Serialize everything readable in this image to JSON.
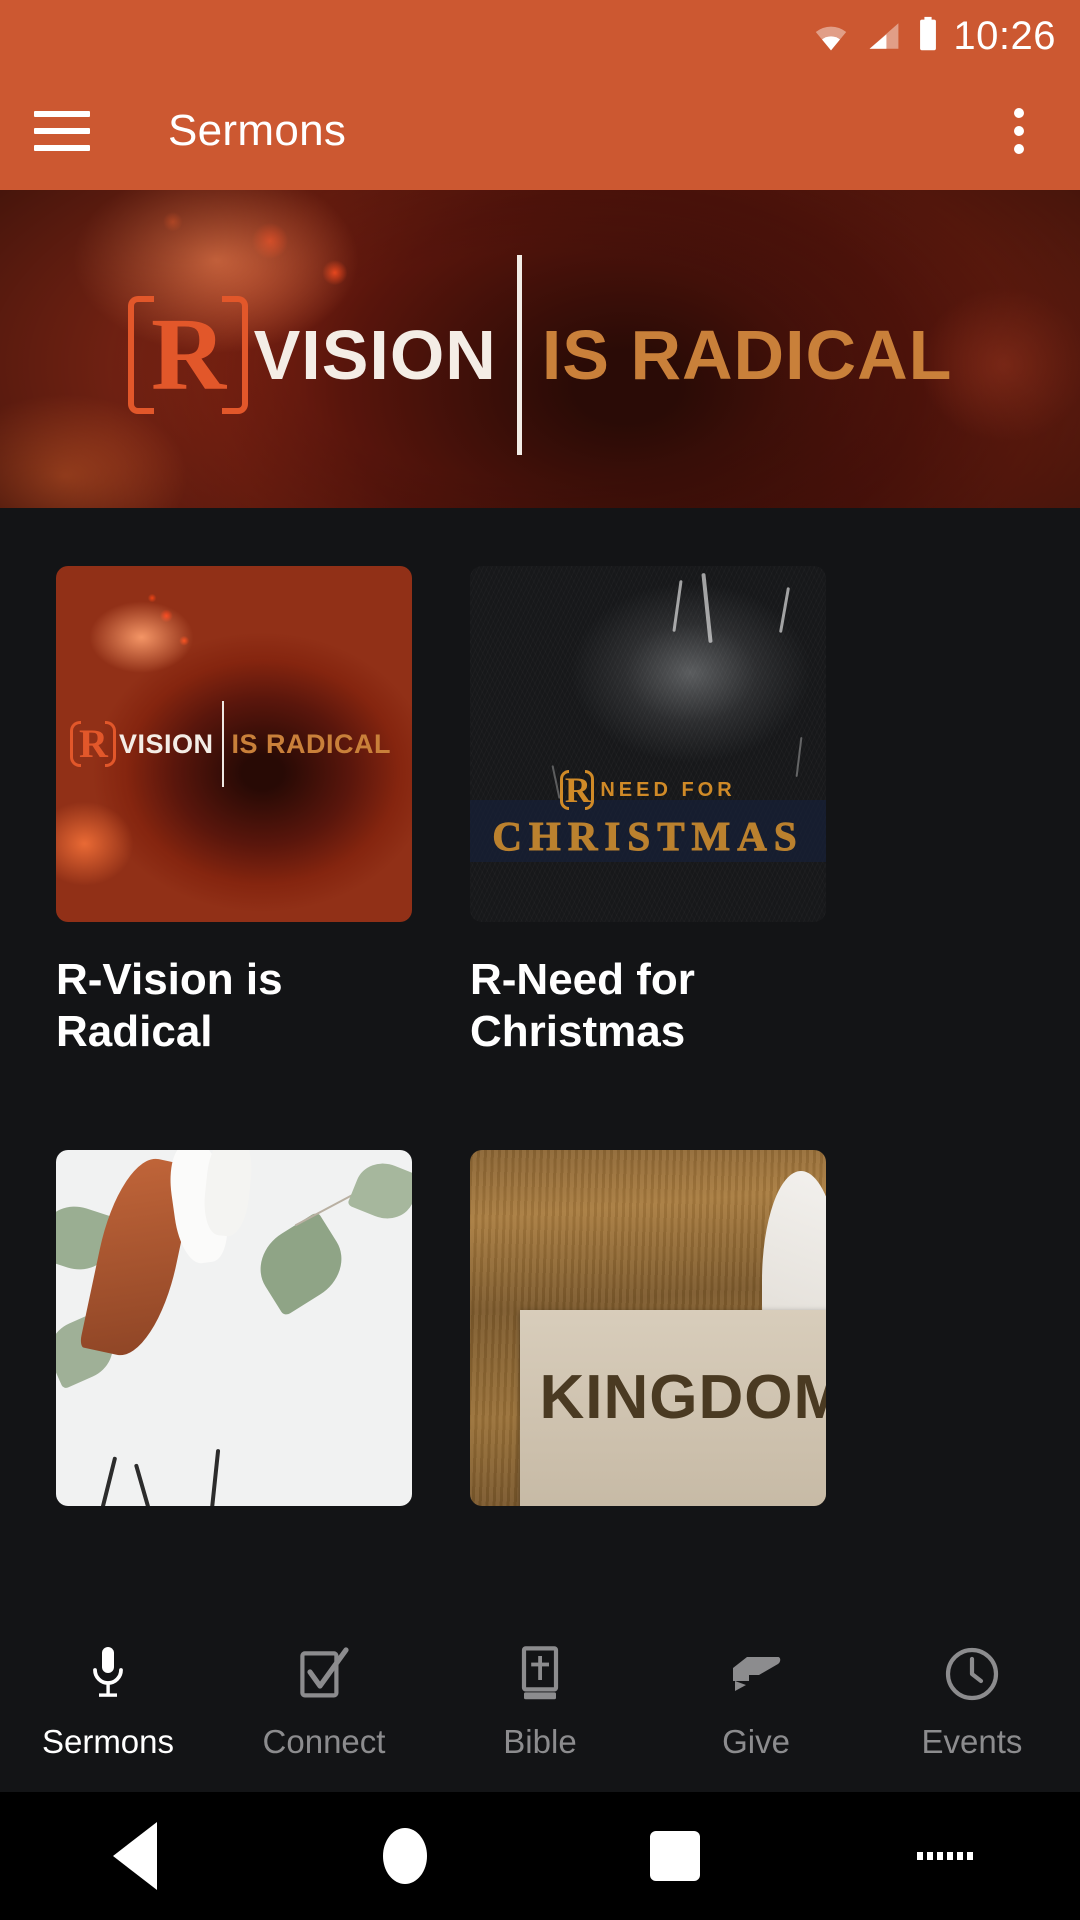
{
  "status_bar": {
    "time": "10:26",
    "icons": [
      "wifi-icon",
      "cellular-signal-icon",
      "battery-icon"
    ]
  },
  "app_bar": {
    "menu_icon": "hamburger-menu-icon",
    "title": "Sermons",
    "overflow_icon": "overflow-menu-icon",
    "background_color": "#CC5831"
  },
  "hero": {
    "logo_letter": "R",
    "word_primary": "VISION",
    "word_secondary": "IS RADICAL",
    "primary_color": "#F4EDE6",
    "secondary_color": "#C9803A",
    "logo_color": "#E2572A"
  },
  "sermon_series": [
    {
      "title": "R-Vision is Radical",
      "thumb_logo_letter": "R",
      "thumb_word_primary": "VISION",
      "thumb_word_secondary": "IS RADICAL"
    },
    {
      "title": "R-Need for Christmas",
      "thumb_logo_letter": "R",
      "thumb_word_primary": "NEED FOR",
      "thumb_word_secondary": "CHRISTMAS"
    },
    {
      "title": "",
      "thumb_word_primary": "",
      "thumb_word_secondary": ""
    },
    {
      "title": "",
      "thumb_word_primary": "KINGDOM",
      "thumb_word_secondary": ""
    }
  ],
  "tab_bar": {
    "active_color": "#FFFFFF",
    "inactive_color": "#8C8C8E",
    "tabs": [
      {
        "label": "Sermons",
        "icon": "microphone-icon",
        "active": true
      },
      {
        "label": "Connect",
        "icon": "checkbox-check-icon",
        "active": false
      },
      {
        "label": "Bible",
        "icon": "bible-book-icon",
        "active": false
      },
      {
        "label": "Give",
        "icon": "giving-hand-icon",
        "active": false
      },
      {
        "label": "Events",
        "icon": "clock-icon",
        "active": false
      }
    ]
  },
  "android_nav": {
    "back": "back-triangle-icon",
    "home": "home-circle-icon",
    "recents": "recents-square-icon",
    "keyboard": "keyboard-icon"
  },
  "theme": {
    "background": "#131416",
    "accent": "#CC5831"
  }
}
